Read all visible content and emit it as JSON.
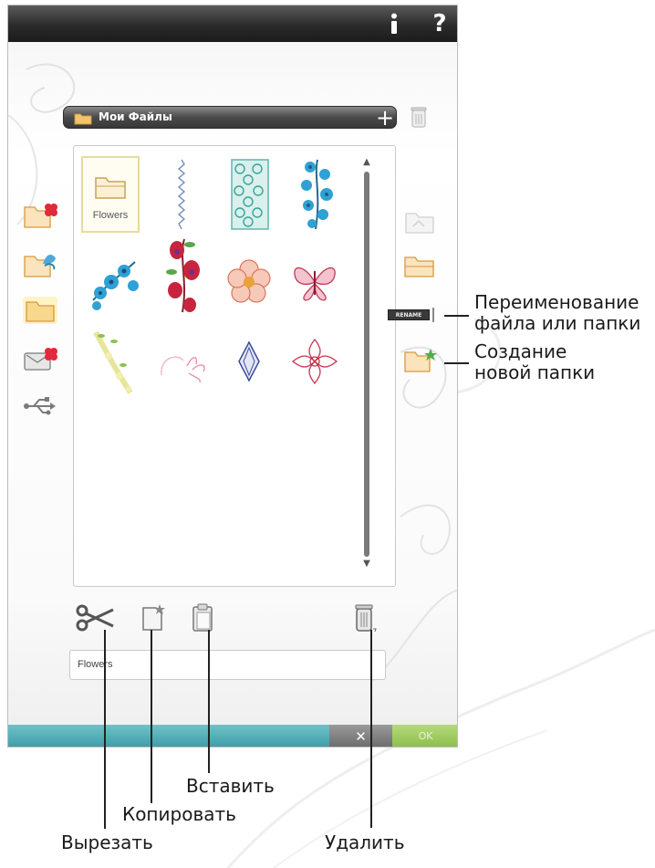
{
  "toolbar": {
    "info_icon": "info-icon",
    "help_label": "?"
  },
  "path": {
    "label": "Мои Файлы",
    "add_symbol": "+"
  },
  "files": [
    {
      "kind": "folder",
      "label": "Flowers",
      "selected": true
    },
    {
      "kind": "design",
      "icon": "stitch-line-design"
    },
    {
      "kind": "design",
      "icon": "teal-lace-block-design"
    },
    {
      "kind": "design",
      "icon": "blue-vine-design"
    },
    {
      "kind": "design",
      "icon": "blue-floral-spray-design"
    },
    {
      "kind": "design",
      "icon": "red-fuchsia-design"
    },
    {
      "kind": "design",
      "icon": "peach-flower-design"
    },
    {
      "kind": "design",
      "icon": "pink-butterfly-design"
    },
    {
      "kind": "design",
      "icon": "green-sprig-design"
    },
    {
      "kind": "design",
      "icon": "pink-swirl-design"
    },
    {
      "kind": "design",
      "icon": "blue-diamond-design"
    },
    {
      "kind": "design",
      "icon": "red-medallion-design"
    }
  ],
  "left_tools": [
    "embroidery-designs-icon",
    "embroidery-fonts-icon",
    "my-files-icon",
    "usb-delete-icon",
    "usb-icon"
  ],
  "right_tools": {
    "rename_badge": "RENAME"
  },
  "name_field": {
    "value": "Flowers"
  },
  "bottom_bar": {
    "cancel_symbol": "✕",
    "ok_label": "OK"
  },
  "annotations": {
    "rename": [
      "Переименование",
      "файла или папки"
    ],
    "new_folder": [
      "Создание",
      "новой папки"
    ],
    "paste": "Вставить",
    "copy": "Копировать",
    "cut": "Вырезать",
    "delete": "Удалить"
  },
  "colors": {
    "teal": "#3d9ba4",
    "ok_green": "#8bbd4a",
    "folder": "#f0b96a",
    "selection": "#e6dc9c"
  }
}
